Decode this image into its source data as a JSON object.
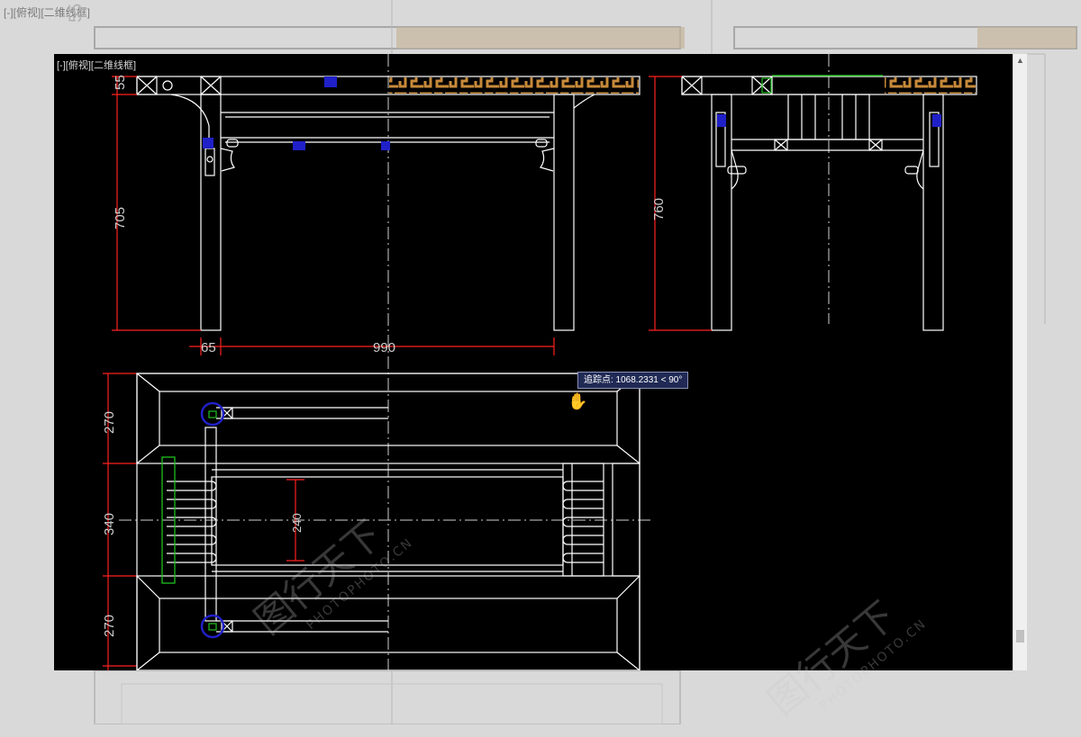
{
  "background": {
    "title": "[-][俯视][二维线框]",
    "dimension": "55"
  },
  "viewport": {
    "label": "[-][俯视][二维线框]"
  },
  "dimensions": {
    "top_height_front": "55",
    "leg_height_front": "705",
    "leg_width": "65",
    "span_width": "990",
    "leg_height_side": "760",
    "plan_depth_a": "270",
    "plan_depth_b": "340",
    "plan_depth_c": "270",
    "inner_width": "240"
  },
  "tooltip": {
    "text": "追踪点: 1068.2331 < 90°"
  },
  "watermark": {
    "brand": "图行天下",
    "url": "PHOTOPHOTO.CN"
  },
  "colors": {
    "line": "#ffffff",
    "dim": "#ff2020",
    "marker": "#2020c8",
    "inlay": "#c88a3a",
    "green": "#20c020"
  },
  "icons": {
    "cursor": "hand-cursor-icon",
    "scroll": "scroll-up-icon"
  }
}
